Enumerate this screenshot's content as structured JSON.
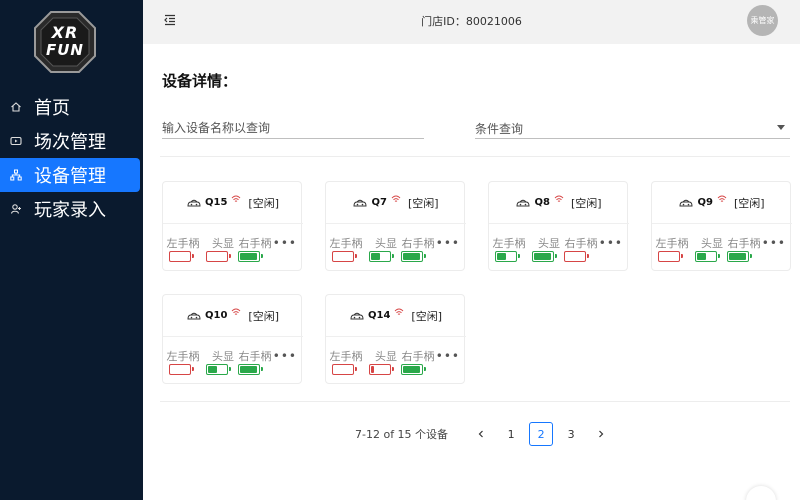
{
  "logo": {
    "line1": "XR",
    "line2": "FUN"
  },
  "nav": [
    {
      "label": "首页",
      "icon": "home-icon",
      "active": false
    },
    {
      "label": "场次管理",
      "icon": "video-icon",
      "active": false
    },
    {
      "label": "设备管理",
      "icon": "network-icon",
      "active": true
    },
    {
      "label": "玩家录入",
      "icon": "user-add-icon",
      "active": false
    }
  ],
  "header": {
    "store_id": "门店ID：80021006",
    "avatar_text": "乘管家"
  },
  "page": {
    "title": "设备详情：",
    "search_placeholder": "输入设备名称以查询",
    "filter_placeholder": "条件查询"
  },
  "slot_labels": [
    "左手柄",
    "头显",
    "右手柄"
  ],
  "devices": [
    {
      "name": "Q15",
      "status": "[空闲]",
      "batteries": [
        {
          "color": "red",
          "level": 0.0
        },
        {
          "color": "red",
          "level": 0.0
        },
        {
          "color": "green",
          "level": 1.0
        }
      ]
    },
    {
      "name": "Q7",
      "status": "[空闲]",
      "batteries": [
        {
          "color": "red",
          "level": 0.0
        },
        {
          "color": "green",
          "level": 0.55
        },
        {
          "color": "green",
          "level": 1.0
        }
      ]
    },
    {
      "name": "Q8",
      "status": "[空闲]",
      "batteries": [
        {
          "color": "green",
          "level": 0.55
        },
        {
          "color": "green",
          "level": 1.0
        },
        {
          "color": "red",
          "level": 0.0
        }
      ]
    },
    {
      "name": "Q9",
      "status": "[空闲]",
      "batteries": [
        {
          "color": "red",
          "level": 0.0
        },
        {
          "color": "green",
          "level": 0.55
        },
        {
          "color": "green",
          "level": 1.0
        }
      ]
    },
    {
      "name": "Q10",
      "status": "[空闲]",
      "batteries": [
        {
          "color": "red",
          "level": 0.0
        },
        {
          "color": "green",
          "level": 0.55
        },
        {
          "color": "green",
          "level": 1.0
        }
      ]
    },
    {
      "name": "Q14",
      "status": "[空闲]",
      "batteries": [
        {
          "color": "red",
          "level": 0.0
        },
        {
          "color": "red",
          "level": 0.15
        },
        {
          "color": "green",
          "level": 1.0
        }
      ]
    }
  ],
  "pagination": {
    "info": "7-12 of 15 个设备",
    "pages": [
      "1",
      "2",
      "3"
    ],
    "current": "2"
  },
  "colors": {
    "sidebar_bg": "#0a1a2e",
    "accent": "#1677ff",
    "battery_ok": "#2aa84a",
    "battery_low": "#d64545",
    "wifi": "#d64545"
  }
}
